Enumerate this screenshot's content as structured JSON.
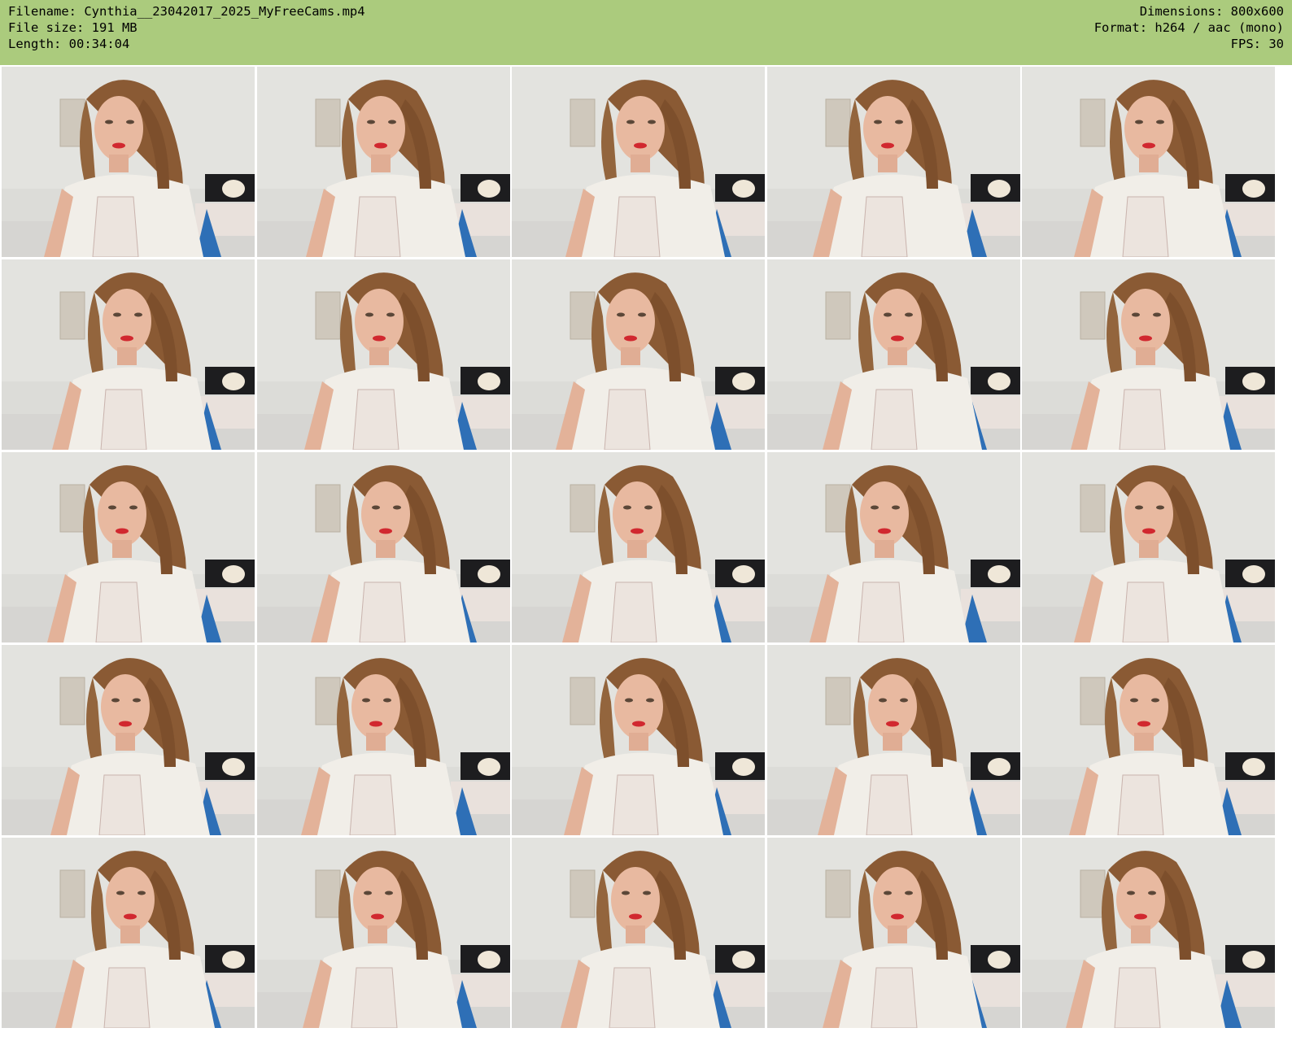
{
  "header": {
    "filename_line": "Filename: Cynthia__23042017_2025_MyFreeCams.mp4",
    "filesize_line": "File size: 191 MB",
    "length_line": "Length: 00:34:04",
    "dimensions_line": "Dimensions: 800x600",
    "format_line": "Format: h264 / aac (mono)",
    "fps_line": "FPS: 30"
  },
  "colors": {
    "header_bg": "#abcb7d",
    "timestamp": "#e8d23a"
  },
  "grid": {
    "rows": 5,
    "cols": 5
  },
  "thumbnails": [
    {
      "label": "webcam-frame"
    },
    {
      "label": "webcam-frame"
    },
    {
      "label": "webcam-frame"
    },
    {
      "label": "webcam-frame"
    },
    {
      "label": "webcam-frame"
    },
    {
      "label": "webcam-frame"
    },
    {
      "label": "webcam-frame"
    },
    {
      "label": "webcam-frame"
    },
    {
      "label": "webcam-frame"
    },
    {
      "label": "webcam-frame"
    },
    {
      "label": "webcam-frame"
    },
    {
      "label": "webcam-frame"
    },
    {
      "label": "webcam-frame"
    },
    {
      "label": "webcam-frame"
    },
    {
      "label": "webcam-frame"
    },
    {
      "label": "webcam-frame"
    },
    {
      "label": "webcam-frame"
    },
    {
      "label": "webcam-frame"
    },
    {
      "label": "webcam-frame"
    },
    {
      "label": "webcam-frame"
    },
    {
      "label": "webcam-frame"
    },
    {
      "label": "webcam-frame"
    },
    {
      "label": "webcam-frame"
    },
    {
      "label": "webcam-frame"
    },
    {
      "label": "webcam-frame"
    }
  ]
}
